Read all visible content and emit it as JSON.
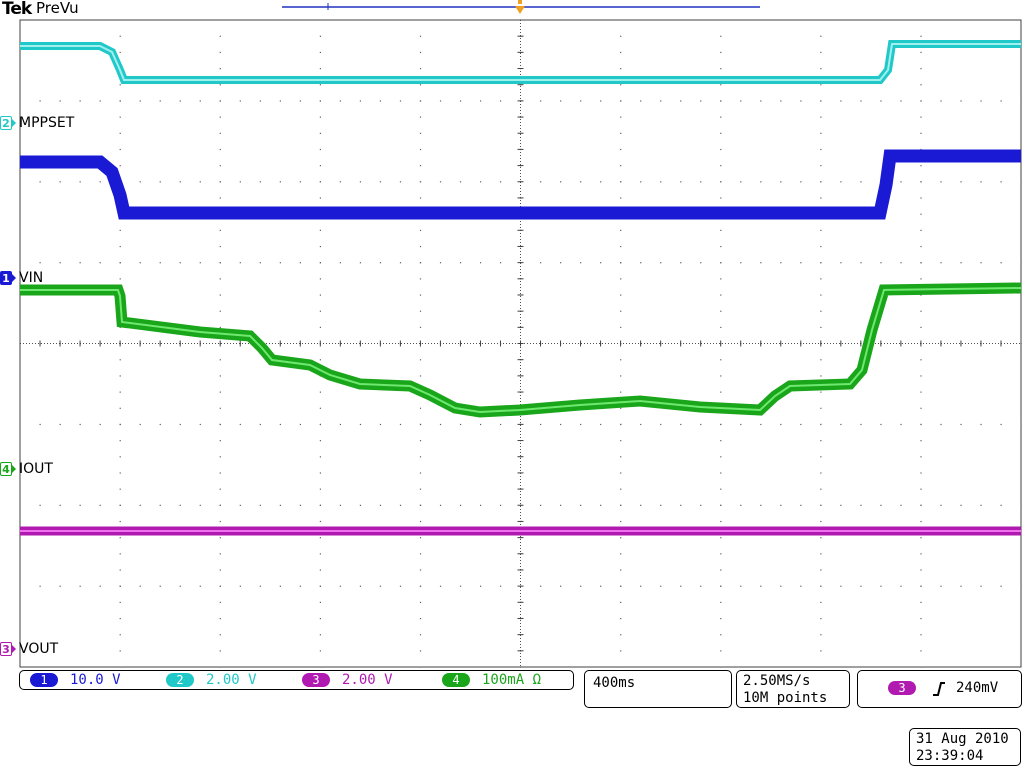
{
  "header": {
    "brand": "Tek",
    "mode": "PreVu"
  },
  "channels": [
    {
      "id": "1",
      "label": "VIN",
      "color": "#1a1ad4"
    },
    {
      "id": "2",
      "label": "MPPSET",
      "color": "#20c8c8"
    },
    {
      "id": "3",
      "label": "VOUT",
      "color": "#b01ab0"
    },
    {
      "id": "4",
      "label": "IOUT",
      "color": "#1aa61a"
    }
  ],
  "settings": {
    "ch1": {
      "num": "1",
      "scale": "10.0 V"
    },
    "ch2": {
      "num": "2",
      "scale": "2.00 V"
    },
    "ch3": {
      "num": "3",
      "scale": "2.00 V"
    },
    "ch4": {
      "num": "4",
      "scale": "100mA Ω"
    }
  },
  "timebase": {
    "per_div": "400ms"
  },
  "acquisition": {
    "sample_rate": "2.50MS/s",
    "record_length": "10M points"
  },
  "trigger": {
    "source": "3",
    "slope_icon": "rising-edge-icon",
    "level": "240mV"
  },
  "datetime": {
    "date": "31 Aug 2010",
    "time": "23:39:04"
  },
  "colors": {
    "grid": "#404040",
    "trigger_marker": "#f0a020",
    "record_bar": "#2030c0"
  }
}
